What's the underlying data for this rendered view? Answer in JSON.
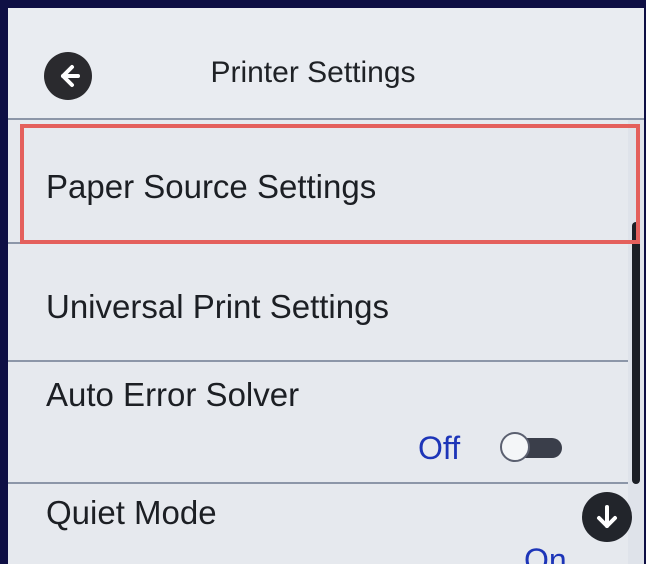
{
  "header": {
    "title": "Printer Settings"
  },
  "items": [
    {
      "label": "Paper Source Settings"
    },
    {
      "label": "Universal Print Settings"
    },
    {
      "label": "Auto Error Solver",
      "status": "Off",
      "toggle_on": false
    },
    {
      "label": "Quiet Mode",
      "status": "On"
    }
  ],
  "colors": {
    "highlight": "#e4605c",
    "status_text": "#1d35b8",
    "screen_bg": "#dfe3ea"
  },
  "icons": {
    "back": "arrow-left-icon",
    "scroll_down": "arrow-down-icon"
  }
}
